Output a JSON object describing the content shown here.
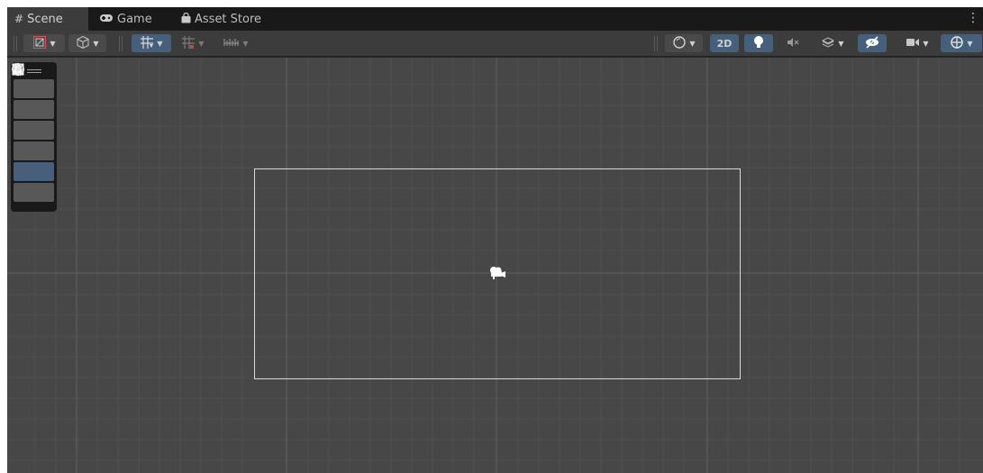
{
  "tabs": [
    {
      "label": "Scene",
      "icon": "grid-hash-icon",
      "active": true
    },
    {
      "label": "Game",
      "icon": "gamepad-icon",
      "active": false
    },
    {
      "label": "Asset Store",
      "icon": "shopping-bag-icon",
      "active": false
    }
  ],
  "toolbar": {
    "mode_2d_label": "2D"
  },
  "tools": [
    {
      "name": "hand-tool",
      "icon": "hand-icon",
      "active": false
    },
    {
      "name": "move-tool",
      "icon": "move-arrows-icon",
      "active": false
    },
    {
      "name": "rotate-tool",
      "icon": "rotate-icon",
      "active": false
    },
    {
      "name": "scale-tool",
      "icon": "scale-icon",
      "active": false
    },
    {
      "name": "rect-tool",
      "icon": "rect-transform-icon",
      "active": true
    },
    {
      "name": "transform-tool",
      "icon": "transform-icon",
      "active": false
    }
  ],
  "colors": {
    "panel": "#282828",
    "tabbar": "#191919",
    "toolbar": "#3c3c3c",
    "scene_background": "#474747",
    "active_blue": "#46607c",
    "camera_frame": "#d8d8d8"
  }
}
